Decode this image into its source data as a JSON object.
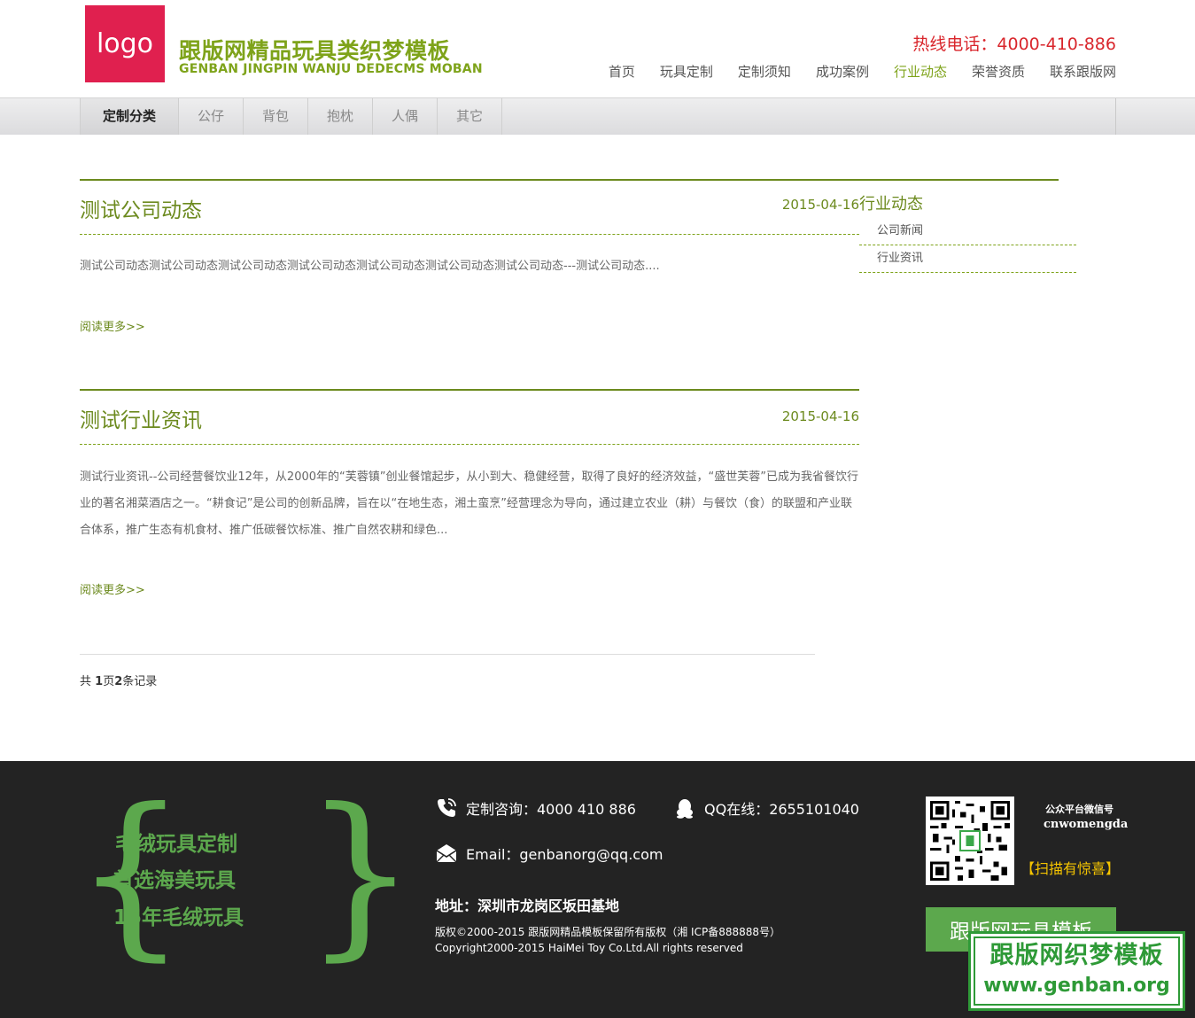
{
  "header": {
    "logo_text": "logo",
    "site_title": "跟版网精品玩具类织梦模板",
    "site_subtitle": "GENBAN JINGPIN WANJU DEDECMS MOBAN",
    "hotline": "热线电话：4000-410-886",
    "nav": [
      {
        "label": "首页",
        "active": false
      },
      {
        "label": "玩具定制",
        "active": false
      },
      {
        "label": "定制须知",
        "active": false
      },
      {
        "label": "成功案例",
        "active": false
      },
      {
        "label": "行业动态",
        "active": true
      },
      {
        "label": "荣誉资质",
        "active": false
      },
      {
        "label": "联系跟版网",
        "active": false
      }
    ]
  },
  "category_bar": {
    "heading": "定制分类",
    "items": [
      "公仔",
      "背包",
      "抱枕",
      "人偶",
      "其它"
    ]
  },
  "sidebar": {
    "title": "行业动态",
    "links": [
      "公司新闻",
      "行业资讯"
    ]
  },
  "articles": [
    {
      "title": "测试公司动态",
      "date": "2015-04-16",
      "summary": "测试公司动态测试公司动态测试公司动态测试公司动态测试公司动态测试公司动态测试公司动态---测试公司动态....",
      "more": "阅读更多>>"
    },
    {
      "title": "测试行业资讯",
      "date": "2015-04-16",
      "summary": "测试行业资讯--公司经营餐饮业12年，从2000年的“芙蓉镇”创业餐馆起步，从小到大、稳健经营，取得了良好的经济效益，“盛世芙蓉”已成为我省餐饮行业的著名湘菜酒店之一。“耕食记”是公司的创新品牌，旨在以“在地生态，湘土蛮烹”经营理念为导向，通过建立农业（耕）与餐饮（食）的联盟和产业联合体系，推广生态有机食材、推广低碳餐饮标准、推广自然农耕和绿色...",
      "more": "阅读更多>>"
    }
  ],
  "pager": {
    "prefix": "共 ",
    "pages": "1",
    "mid": "页",
    "records": "2",
    "suffix": "条记录"
  },
  "footer": {
    "slogans": [
      "毛绒玩具定制",
      "首选海美玩具",
      "15年毛绒玩具"
    ],
    "phone": "定制咨询：4000 410 886",
    "qq": "QQ在线：2655101040",
    "email": "Email：genbanorg@qq.com",
    "address": "地址：深圳市龙岗区坂田基地",
    "copyright_cn": "版权©2000-2015 跟版网精品模板保留所有版权（湘 ICP备888888号）",
    "copyright_en": "Copyright2000-2015 HaiMei Toy Co.Ltd.All rights reserved",
    "wechat_label": "公众平台微信号",
    "wechat_id": "cnwomengda",
    "scan_text": "【扫描有惊喜】",
    "button_label": "跟版网玩具模板"
  },
  "watermark": {
    "line1": "跟版网织梦模板",
    "line2": "www.genban.org"
  },
  "colors": {
    "accent_green": "#6c8a1e",
    "title_green": "#7ea31a",
    "logo_red": "#e0204f",
    "hotline_red": "#d9262c",
    "footer_bg": "#232323",
    "footer_green": "#5ca84d",
    "scan_yellow": "#f5c400"
  },
  "icons": {
    "phone": "phone-icon",
    "qq": "qq-penguin-icon",
    "email": "envelope-icon",
    "qr": "qr-code-icon"
  }
}
